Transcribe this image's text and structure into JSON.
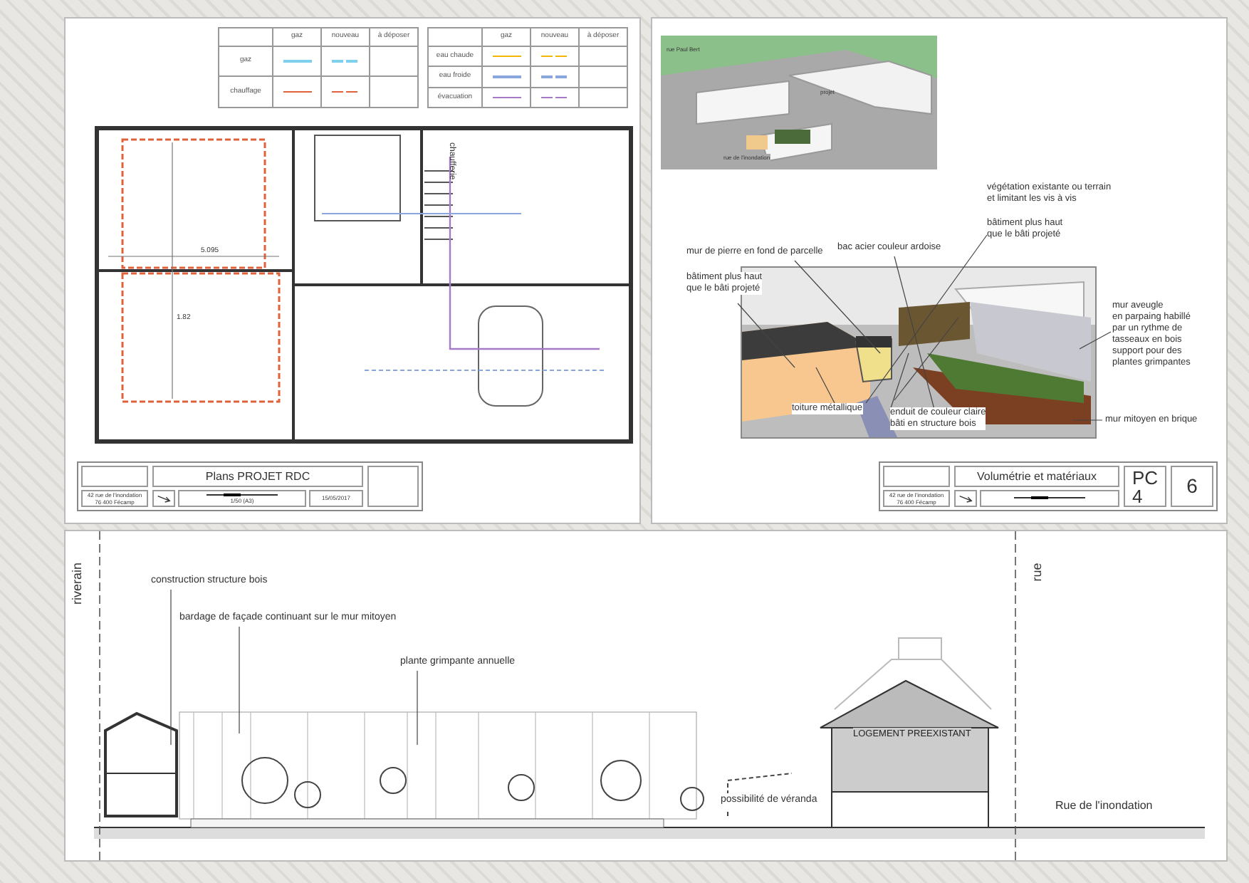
{
  "plan_sheet": {
    "legend_tables": [
      {
        "columns": [
          "gaz",
          "nouveau",
          "à déposer"
        ],
        "rows": [
          {
            "label": "gaz",
            "color": "#7fd0ec"
          },
          {
            "label": "chauffage",
            "color": "#e0623c"
          }
        ]
      },
      {
        "columns": [
          "gaz",
          "nouveau",
          "à déposer"
        ],
        "rows": [
          {
            "label": "eau chaude",
            "color": "#f2b705"
          },
          {
            "label": "eau froide",
            "color": "#8aa6dc"
          },
          {
            "label": "évacuation",
            "color": "#a57bc8"
          }
        ]
      }
    ],
    "plan_labels": [
      "chaufferie",
      "5.095",
      "1.82"
    ],
    "title_block": {
      "title": "Plans PROJET RDC",
      "address": [
        "42 rue de l'inondation",
        "76 400 Fécamp"
      ],
      "scale": "1/50 (A3)",
      "date": "15/05/2017"
    }
  },
  "volume_sheet": {
    "site_labels": [
      "rue Paul Bert",
      "projet",
      "rue de l'inondation"
    ],
    "annotations": [
      {
        "lines": [
          "végétation existante ou terrain",
          "et limitant les vis à vis"
        ]
      },
      {
        "lines": [
          "bâtiment plus haut",
          "que le bâti projeté"
        ]
      },
      {
        "lines": [
          "mur de pierre en fond de parcelle"
        ]
      },
      {
        "lines": [
          "bac acier couleur ardoise"
        ]
      },
      {
        "lines": [
          "bâtiment plus haut",
          "que le bâti projeté"
        ]
      },
      {
        "lines": [
          "mur aveugle",
          "en parpaing habillé",
          "par un rythme de",
          "tasseaux en bois",
          "support pour des",
          "plantes grimpantes"
        ]
      },
      {
        "lines": [
          "toiture métallique"
        ]
      },
      {
        "lines": [
          "enduit de couleur claire",
          "bâti en structure bois"
        ]
      },
      {
        "lines": [
          "mur mitoyen en brique"
        ]
      }
    ],
    "title_block": {
      "title": "Volumétrie et matériaux",
      "address": [
        "42 rue de l'inondation",
        "76 400 Fécamp"
      ],
      "code": [
        "PC",
        "4"
      ],
      "page": "6"
    }
  },
  "section": {
    "side_labels": [
      "riverain",
      "rue"
    ],
    "annotations": [
      "construction structure bois",
      "bardage de façade continuant sur le mur mitoyen",
      "plante grimpante annuelle",
      "possibilité de véranda"
    ],
    "building_label": "LOGEMENT PREEXISTANT",
    "street": "Rue de l'inondation"
  }
}
